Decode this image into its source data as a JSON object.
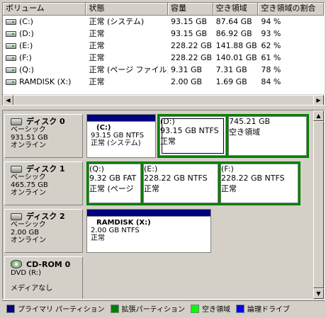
{
  "volume_list": {
    "columns": [
      "ボリューム",
      "状態",
      "容量",
      "空き領域",
      "空き領域の割合"
    ],
    "rows": [
      {
        "name": "(C:)",
        "status": "正常 (システム)",
        "capacity": "93.15 GB",
        "free": "87.64 GB",
        "pct": "94 %"
      },
      {
        "name": "(D:)",
        "status": "正常",
        "capacity": "93.15 GB",
        "free": "86.92 GB",
        "pct": "93 %"
      },
      {
        "name": "(E:)",
        "status": "正常",
        "capacity": "228.22 GB",
        "free": "141.88 GB",
        "pct": "62 %"
      },
      {
        "name": "(F:)",
        "status": "正常",
        "capacity": "228.22 GB",
        "free": "140.01 GB",
        "pct": "61 %"
      },
      {
        "name": "(Q:)",
        "status": "正常 (ページ ファイル)",
        "capacity": "9.31 GB",
        "free": "7.31 GB",
        "pct": "78 %"
      },
      {
        "name": "RAMDISK (X:)",
        "status": "正常",
        "capacity": "2.00 GB",
        "free": "1.69 GB",
        "pct": "84 %"
      }
    ],
    "scroll_left": "◀",
    "scroll_right": "▶"
  },
  "disks": [
    {
      "title": "ディスク 0",
      "type": "ベーシック",
      "size": "931.51 GB",
      "state": "オンライン",
      "partitions": [
        {
          "name": "(C:)",
          "detail": "93.15 GB NTFS",
          "status": "正常 (システム)",
          "kind": "primary"
        },
        {
          "name": "(D:)",
          "detail": "93.15 GB NTFS",
          "status": "正常",
          "kind": "logical"
        },
        {
          "name": "",
          "detail": "745.21 GB",
          "status": "空き領域",
          "kind": "free"
        }
      ]
    },
    {
      "title": "ディスク 1",
      "type": "ベーシック",
      "size": "465.75 GB",
      "state": "オンライン",
      "partitions": [
        {
          "name": "(Q:)",
          "detail": "9.32 GB FAT",
          "status": "正常 (ページ",
          "kind": "logical"
        },
        {
          "name": "(E:)",
          "detail": "228.22 GB NTFS",
          "status": "正常",
          "kind": "logical"
        },
        {
          "name": "(F:)",
          "detail": "228.22 GB NTFS",
          "status": "正常",
          "kind": "logical"
        }
      ]
    },
    {
      "title": "ディスク 2",
      "type": "ベーシック",
      "size": "2.00 GB",
      "state": "オンライン",
      "partitions": [
        {
          "name": "RAMDISK  (X:)",
          "detail": "2.00 GB NTFS",
          "status": "正常",
          "kind": "primary"
        }
      ]
    },
    {
      "title": "CD-ROM 0",
      "type": "DVD (R:)",
      "size": "",
      "state": "メディアなし",
      "partitions": []
    }
  ],
  "vscroll": {
    "up": "▲",
    "down": "▼"
  },
  "legend": [
    {
      "label": "プライマリ パーティション",
      "color": "#000080"
    },
    {
      "label": "拡張パーティション",
      "color": "#008000"
    },
    {
      "label": "空き領域",
      "color": "#00ff00"
    },
    {
      "label": "論理ドライブ",
      "color": "#0000ff"
    }
  ],
  "colors": {
    "primary": "#000080",
    "extended": "#008000",
    "free": "#00ff00",
    "logical": "#0000ff"
  }
}
